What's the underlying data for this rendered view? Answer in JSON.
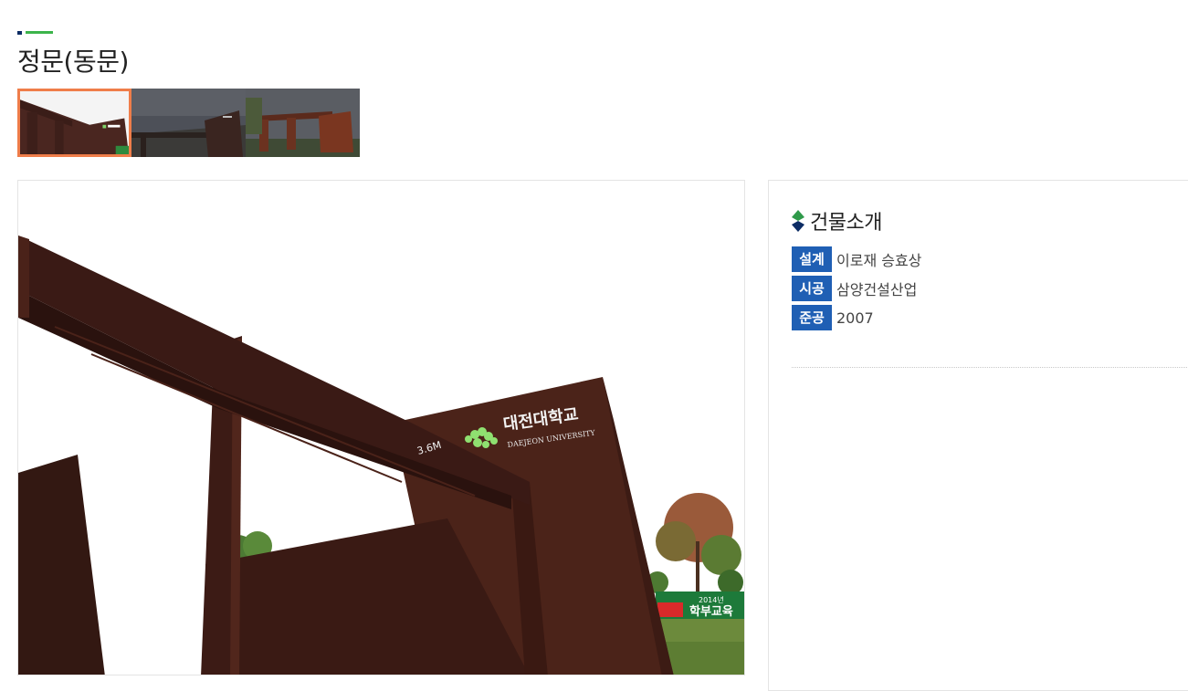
{
  "page": {
    "title": "정문(동문)"
  },
  "thumbnails": [
    {
      "label": "thumbnail-1",
      "active": true
    },
    {
      "label": "thumbnail-2",
      "active": false
    },
    {
      "label": "thumbnail-3",
      "active": false
    }
  ],
  "photo": {
    "sign_korean": "대전대학교",
    "sign_english": "DAEJEON UNIVERSITY",
    "height_mark": "3.6M",
    "banner_text": "학부교육",
    "banner_year": "2014년"
  },
  "info": {
    "heading": "건물소개",
    "rows": [
      {
        "key": "설계",
        "value": "이로재 승효상"
      },
      {
        "key": "시공",
        "value": "삼양건설산업"
      },
      {
        "key": "준공",
        "value": "2007"
      }
    ]
  },
  "colors": {
    "accent_blue": "#1f5fb4",
    "active_border": "#ef7d4a",
    "brand_green": "#3cb44b",
    "navy": "#0c2c64"
  }
}
